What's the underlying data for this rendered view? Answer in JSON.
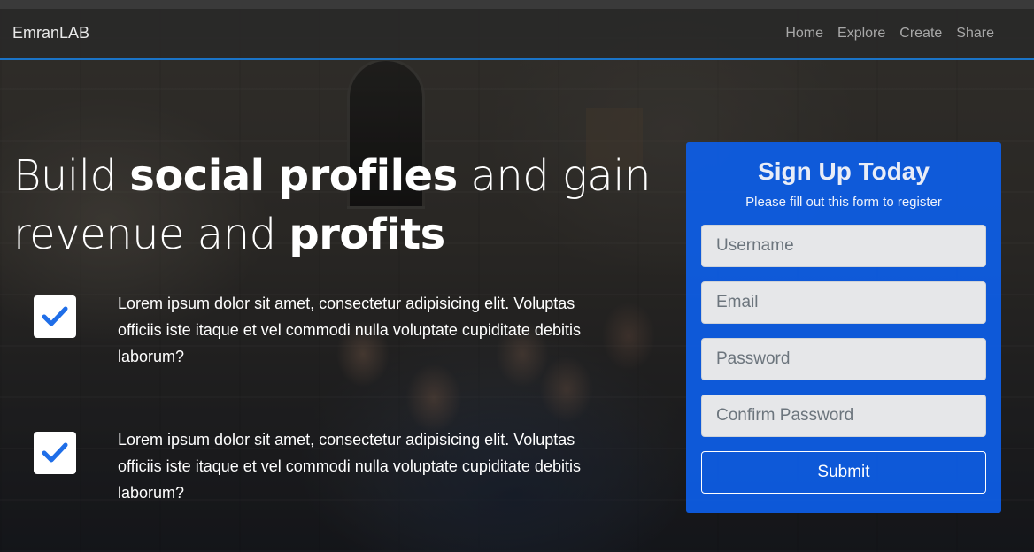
{
  "navbar": {
    "brand": "EmranLAB",
    "links": [
      "Home",
      "Explore",
      "Create",
      "Share"
    ]
  },
  "hero": {
    "headline": {
      "p1": "Build ",
      "b1": "social profiles",
      "p2": " and gain revenue and ",
      "b2": "profits"
    },
    "features": [
      {
        "icon": "check-icon",
        "text": "Lorem ipsum dolor sit amet, consectetur adipisicing elit. Voluptas officiis iste itaque et vel commodi nulla voluptate cupiditate debitis laborum?"
      },
      {
        "icon": "check-icon",
        "text": "Lorem ipsum dolor sit amet, consectetur adipisicing elit. Voluptas officiis iste itaque et vel commodi nulla voluptate cupiditate debitis laborum?"
      }
    ]
  },
  "signup": {
    "title": "Sign Up Today",
    "subtitle": "Please fill out this form to register",
    "fields": {
      "username": {
        "placeholder": "Username",
        "value": ""
      },
      "email": {
        "placeholder": "Email",
        "value": ""
      },
      "password": {
        "placeholder": "Password",
        "value": ""
      },
      "confirm_password": {
        "placeholder": "Confirm Password",
        "value": ""
      }
    },
    "submit_label": "Submit"
  },
  "colors": {
    "accent": "#1a74c8",
    "card": "#0d5ee8",
    "check": "#1f6ee8"
  }
}
